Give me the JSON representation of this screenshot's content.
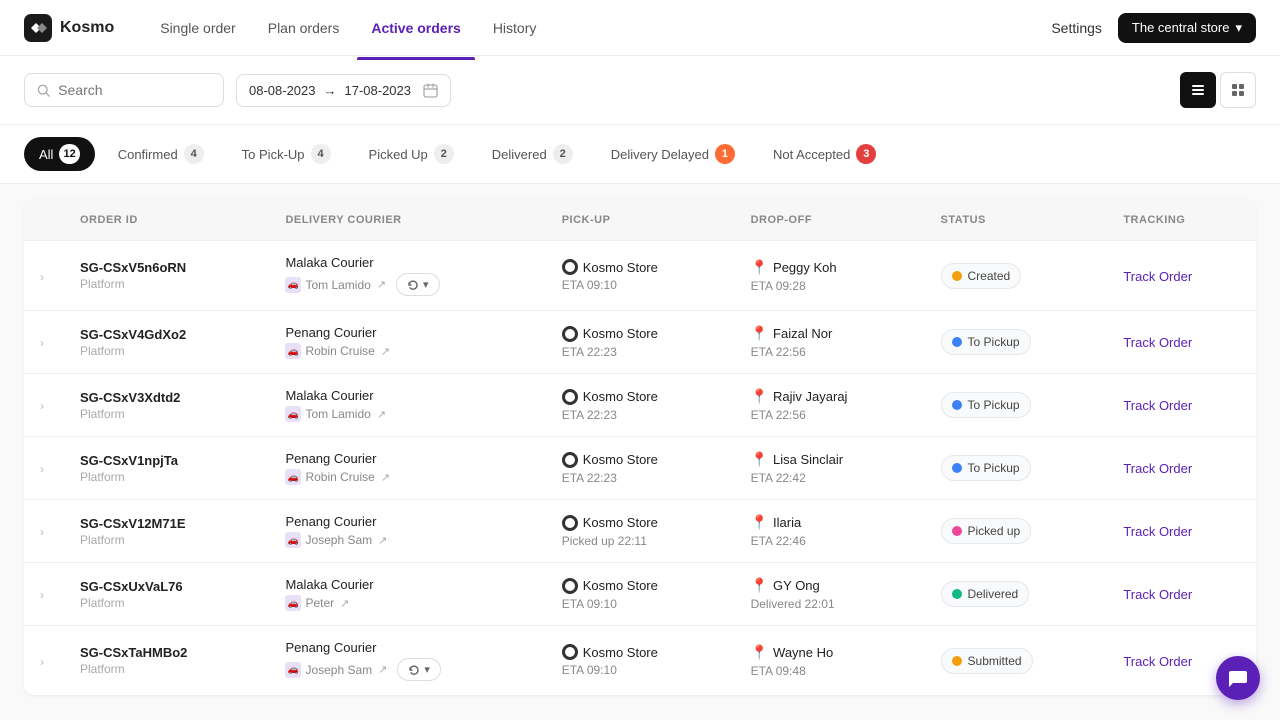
{
  "brand": "Kosmo",
  "nav": {
    "links": [
      "Single order",
      "Plan orders",
      "Active orders",
      "History"
    ],
    "active": "Active orders",
    "settings": "Settings",
    "store": "The central store"
  },
  "toolbar": {
    "search_placeholder": "Search",
    "date_from": "08-08-2023",
    "date_to": "17-08-2023"
  },
  "filter_tabs": [
    {
      "label": "All",
      "count": "12",
      "state": "active"
    },
    {
      "label": "Confirmed",
      "count": "4",
      "state": ""
    },
    {
      "label": "To Pick-Up",
      "count": "4",
      "state": ""
    },
    {
      "label": "Picked Up",
      "count": "2",
      "state": ""
    },
    {
      "label": "Delivered",
      "count": "2",
      "state": ""
    },
    {
      "label": "Delivery Delayed",
      "count": "1",
      "state": "delayed"
    },
    {
      "label": "Not Accepted",
      "count": "3",
      "state": "not-accepted"
    }
  ],
  "table": {
    "columns": [
      "ORDER ID",
      "DELIVERY COURIER",
      "PICK-UP",
      "DROP-OFF",
      "STATUS",
      "TRACKING"
    ],
    "rows": [
      {
        "id": "SG-CSxV5n6oRN",
        "type": "Platform",
        "courier": "Malaka Courier",
        "courier_person": "Tom Lamido",
        "has_refresh": true,
        "pickup": "Kosmo Store",
        "pickup_eta": "ETA 09:10",
        "dropoff": "Peggy Koh",
        "dropoff_eta": "ETA 09:28",
        "status": "Created",
        "status_dot": "yellow",
        "tracking": "Track Order"
      },
      {
        "id": "SG-CSxV4GdXo2",
        "type": "Platform",
        "courier": "Penang Courier",
        "courier_person": "Robin Cruise",
        "has_refresh": false,
        "pickup": "Kosmo Store",
        "pickup_eta": "ETA 22:23",
        "dropoff": "Faizal Nor",
        "dropoff_eta": "ETA 22:56",
        "status": "To Pickup",
        "status_dot": "blue",
        "tracking": "Track Order"
      },
      {
        "id": "SG-CSxV3Xdtd2",
        "type": "Platform",
        "courier": "Malaka Courier",
        "courier_person": "Tom Lamido",
        "has_refresh": false,
        "pickup": "Kosmo Store",
        "pickup_eta": "ETA 22:23",
        "dropoff": "Rajiv Jayaraj",
        "dropoff_eta": "ETA 22:56",
        "status": "To Pickup",
        "status_dot": "blue",
        "tracking": "Track Order"
      },
      {
        "id": "SG-CSxV1npjTa",
        "type": "Platform",
        "courier": "Penang Courier",
        "courier_person": "Robin Cruise",
        "has_refresh": false,
        "pickup": "Kosmo Store",
        "pickup_eta": "ETA 22:23",
        "dropoff": "Lisa Sinclair",
        "dropoff_eta": "ETA 22:42",
        "status": "To Pickup",
        "status_dot": "blue",
        "tracking": "Track Order"
      },
      {
        "id": "SG-CSxV12M71E",
        "type": "Platform",
        "courier": "Penang Courier",
        "courier_person": "Joseph Sam",
        "has_refresh": false,
        "pickup": "Kosmo Store",
        "pickup_eta": "Picked up 22:11",
        "dropoff": "Ilaria",
        "dropoff_eta": "ETA 22:46",
        "status": "Picked up",
        "status_dot": "pink",
        "tracking": "Track Order"
      },
      {
        "id": "SG-CSxUxVaL76",
        "type": "Platform",
        "courier": "Malaka Courier",
        "courier_person": "Peter",
        "has_refresh": false,
        "pickup": "Kosmo Store",
        "pickup_eta": "ETA 09:10",
        "dropoff": "GY Ong",
        "dropoff_eta": "Delivered 22:01",
        "status": "Delivered",
        "status_dot": "green",
        "tracking": "Track Order"
      },
      {
        "id": "SG-CSxTaHMBo2",
        "type": "Platform",
        "courier": "Penang Courier",
        "courier_person": "Joseph Sam",
        "has_refresh": true,
        "pickup": "Kosmo Store",
        "pickup_eta": "ETA 09:10",
        "dropoff": "Wayne Ho",
        "dropoff_eta": "ETA 09:48",
        "status": "Submitted",
        "status_dot": "yellow",
        "tracking": "Track Order"
      }
    ]
  }
}
